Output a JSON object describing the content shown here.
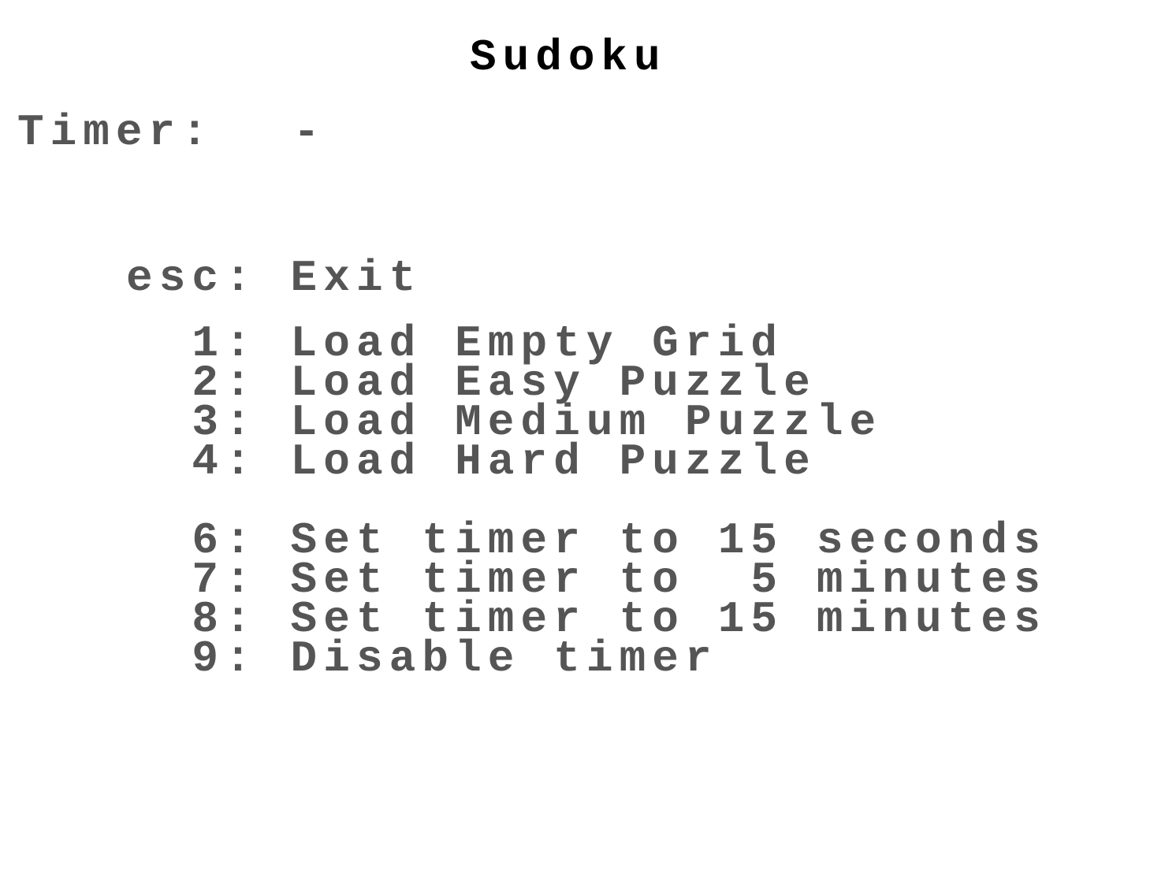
{
  "title": "Sudoku",
  "timer": {
    "label": "Timer:",
    "value": "-"
  },
  "menu": [
    {
      "key": "esc:",
      "label": "Exit"
    },
    {
      "key": "  1:",
      "label": "Load Empty Grid"
    },
    {
      "key": "  2:",
      "label": "Load Easy Puzzle"
    },
    {
      "key": "  3:",
      "label": "Load Medium Puzzle"
    },
    {
      "key": "  4:",
      "label": "Load Hard Puzzle"
    },
    {
      "key": "  6:",
      "label": "Set timer to 15 seconds"
    },
    {
      "key": "  7:",
      "label": "Set timer to  5 minutes"
    },
    {
      "key": "  8:",
      "label": "Set timer to 15 minutes"
    },
    {
      "key": "  9:",
      "label": "Disable timer"
    }
  ],
  "colors": {
    "text": "#555555",
    "title": "#000000",
    "background": "#ffffff"
  }
}
